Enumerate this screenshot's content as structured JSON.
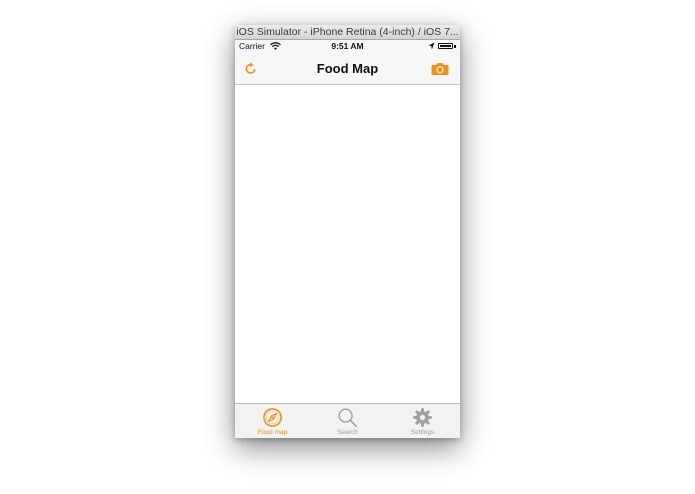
{
  "window": {
    "title": "iOS Simulator - iPhone Retina (4-inch) / iOS 7..."
  },
  "status_bar": {
    "carrier": "Carrier",
    "time": "9:51 AM",
    "battery_level": 1.0
  },
  "nav_bar": {
    "title": "Food Map",
    "left_icon": "refresh-icon",
    "right_icon": "camera-icon"
  },
  "tab_bar": {
    "active_index": 0,
    "tabs": [
      {
        "label": "Food map",
        "icon": "compass-icon"
      },
      {
        "label": "Search",
        "icon": "search-icon"
      },
      {
        "label": "Settings",
        "icon": "gear-icon"
      }
    ]
  },
  "colors": {
    "accent": "#f0901e",
    "inactive": "#a0a0a0",
    "bar_background": "#f7f7f7"
  }
}
